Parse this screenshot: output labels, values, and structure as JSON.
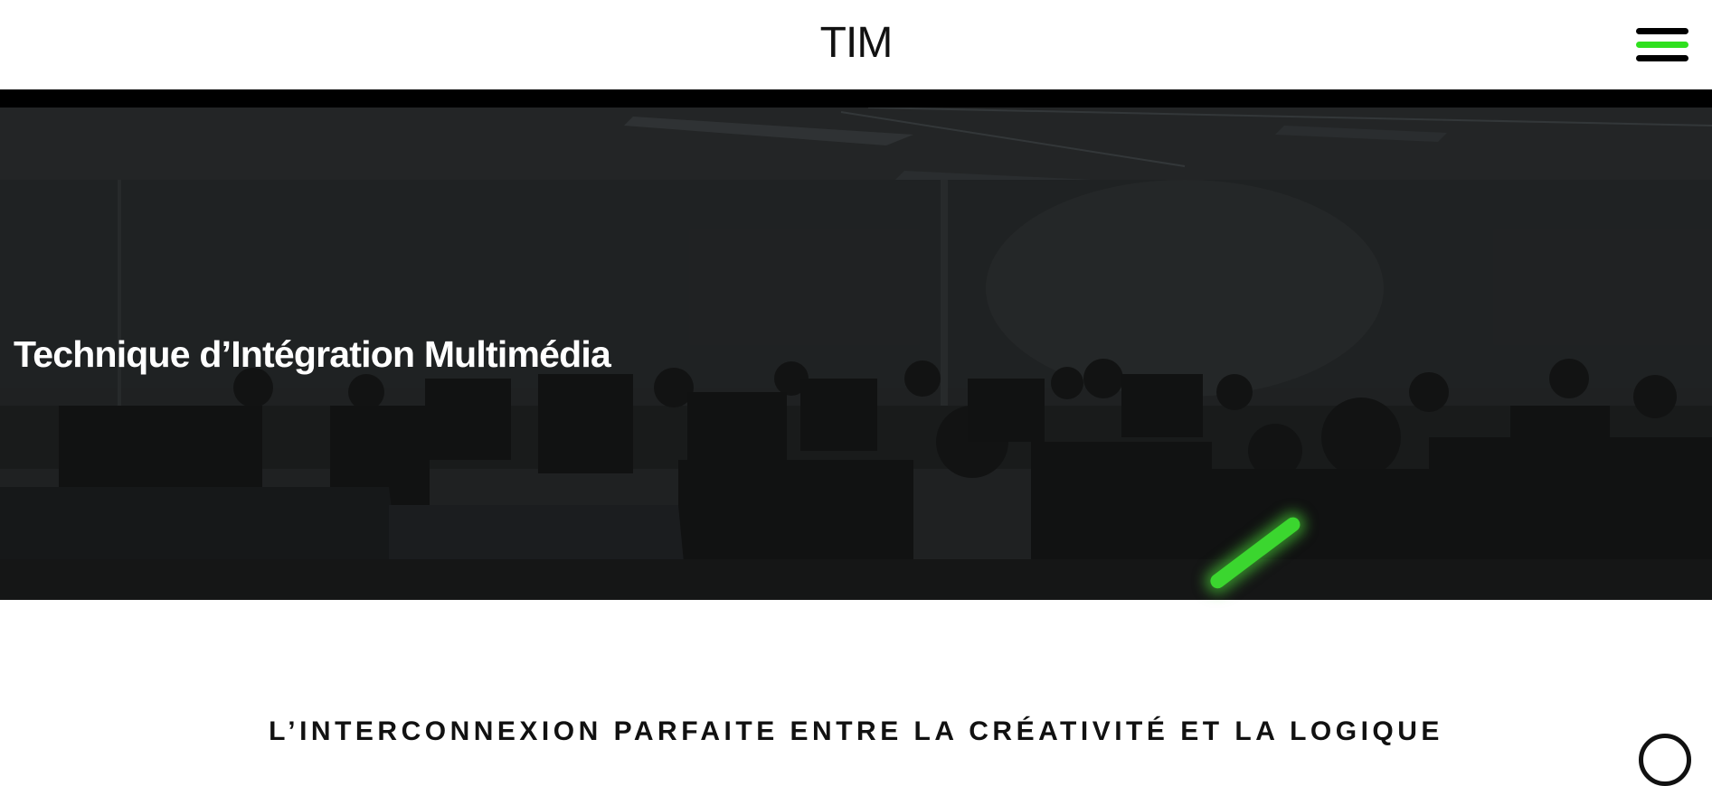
{
  "header": {
    "title": "TIM",
    "menu_icon_colors": [
      "#000000",
      "#2fe01e",
      "#000000"
    ]
  },
  "hero": {
    "title": "Technique d’Intégration Multimédia",
    "image": "classroom-photo"
  },
  "tagline": "L’INTERCONNEXION PARFAITE ENTRE LA CRÉATIVITÉ ET LA LOGIQUE",
  "colors": {
    "accent": "#2fe01e",
    "text": "#111111",
    "background": "#ffffff"
  }
}
